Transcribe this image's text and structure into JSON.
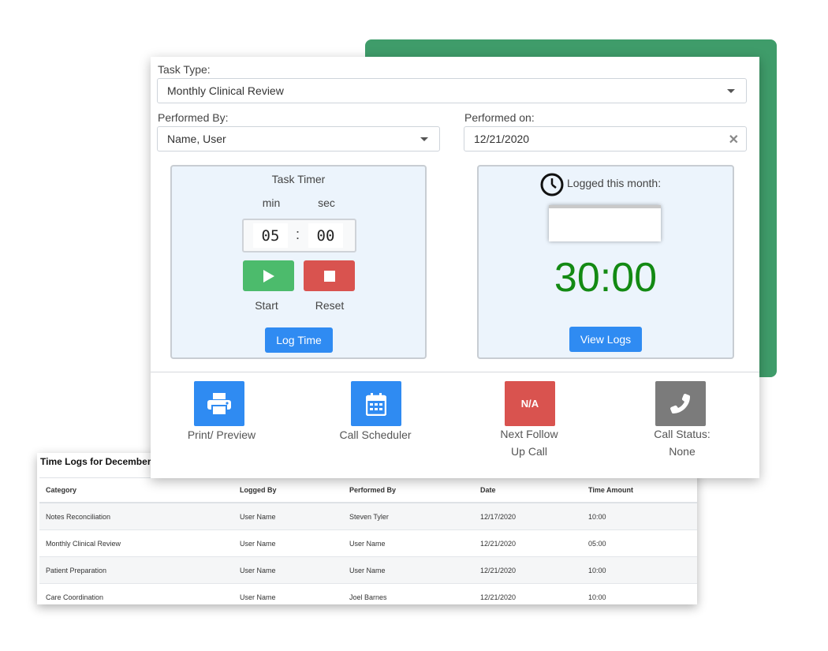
{
  "form": {
    "task_type_label": "Task Type:",
    "task_type_value": "Monthly Clinical Review",
    "performed_by_label": "Performed By:",
    "performed_by_value": "Name, User",
    "performed_on_label": "Performed on:",
    "performed_on_value": "12/21/2020"
  },
  "timer": {
    "title": "Task Timer",
    "min_label": "min",
    "sec_label": "sec",
    "minutes": "05",
    "colon": ":",
    "seconds": "00",
    "start_label": "Start",
    "reset_label": "Reset",
    "log_time_label": "Log Time"
  },
  "monthly": {
    "title": "Logged this month:",
    "total": "30:00",
    "view_logs_label": "View Logs"
  },
  "actions": [
    {
      "line1": "Print/ Preview",
      "line2": "",
      "icon": "printer-icon",
      "color": "#2f8bf2"
    },
    {
      "line1": "Call Scheduler",
      "line2": "",
      "icon": "calendar-icon",
      "color": "#2f8bf2"
    },
    {
      "line1": "Next Follow",
      "line2": "Up Call",
      "icon": "na-badge",
      "badge_text": "N/A",
      "color": "#d9534f"
    },
    {
      "line1": "Call Status:",
      "line2": "None",
      "icon": "phone-icon",
      "color": "#7b7b7b"
    }
  ],
  "colors": {
    "accent_green": "#3f9c6a",
    "primary_blue": "#2f8bf2",
    "start_green": "#4cbb6c",
    "reset_red": "#d9534f",
    "time_green": "#138a13"
  },
  "logs": {
    "title": "Time Logs for December",
    "columns": [
      "Category",
      "Logged By",
      "Performed By",
      "Date",
      "Time Amount"
    ],
    "rows": [
      [
        "Notes Reconciliation",
        "User Name",
        "Steven Tyler",
        "12/17/2020",
        "10:00"
      ],
      [
        "Monthly Clinical Review",
        "User Name",
        "User Name",
        "12/21/2020",
        "05:00"
      ],
      [
        "Patient Preparation",
        "User Name",
        "User Name",
        "12/21/2020",
        "10:00"
      ],
      [
        "Care Coordination",
        "User Name",
        "Joel Barnes",
        "12/21/2020",
        "10:00"
      ]
    ]
  }
}
